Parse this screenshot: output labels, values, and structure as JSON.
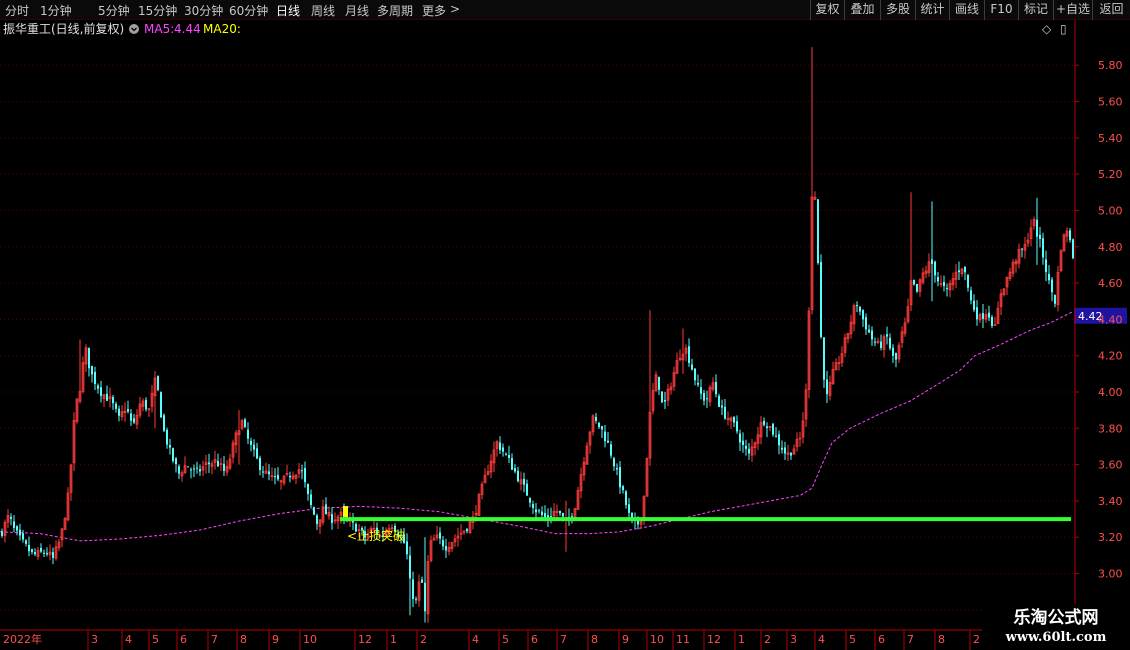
{
  "toolbar": {
    "periods": [
      "分时",
      "1分钟",
      "5分钟",
      "15分钟",
      "30分钟",
      "60分钟",
      "日线",
      "周线",
      "月线",
      "多周期",
      "更多"
    ],
    "active_period": "日线",
    "more_arrow": ">",
    "tools": [
      "复权",
      "叠加",
      "多股",
      "统计",
      "画线",
      "F10",
      "标记",
      "+自选",
      "返回"
    ]
  },
  "info": {
    "stock_name": "振华重工(日线,前复权)",
    "ma5_label": "MA5:",
    "ma5_value": "4.44",
    "ma20_label": "MA20:",
    "ma20_value": "",
    "diamond_icon": "◇",
    "panel_icon": "▯"
  },
  "colors": {
    "up": "#ff3c3c",
    "down": "#54ffff",
    "ma": "#ff44ff",
    "support": "#33ff33",
    "annotation": "#ffff00",
    "axis": "#b40000",
    "grid": "#5a0000",
    "price_tag": "#1e14a0",
    "ma5_label": "#ffffff",
    "ma5_value": "#ff44ff",
    "ma20_label": "#ffff00"
  },
  "chart_data": {
    "type": "candlestick",
    "ylim": [
      2.7,
      5.95
    ],
    "yticks": [
      2.8,
      3.0,
      3.2,
      3.4,
      3.6,
      3.8,
      4.0,
      4.2,
      4.4,
      4.6,
      4.8,
      5.0,
      5.2,
      5.4,
      5.6,
      5.8
    ],
    "ytick_labels": [
      "2.80",
      "3.00",
      "3.20",
      "3.40",
      "3.60",
      "3.80",
      "4.00",
      "4.20",
      "4.40",
      "4.60",
      "4.80",
      "5.00",
      "5.20",
      "5.40",
      "5.60",
      "5.80"
    ],
    "x_tick_labels": [
      "2022年",
      "3",
      "4",
      "5",
      "6",
      "7",
      "8",
      "9",
      "10",
      "12",
      "1",
      "2",
      "4",
      "5",
      "6",
      "7",
      "8",
      "9",
      "10",
      "11",
      "12",
      "1",
      "2",
      "3",
      "4",
      "5",
      "6",
      "7",
      "8",
      "2"
    ],
    "last_price": 4.42,
    "last_price_label": "4.42",
    "support_level": 3.3,
    "annotation": "<止损突破",
    "price_path": [
      [
        0,
        3.22
      ],
      [
        8,
        3.32
      ],
      [
        12,
        3.25
      ],
      [
        20,
        3.18
      ],
      [
        32,
        3.1
      ],
      [
        45,
        3.12
      ],
      [
        52,
        3.08
      ],
      [
        60,
        3.2
      ],
      [
        68,
        3.45
      ],
      [
        74,
        3.9
      ],
      [
        80,
        4.05
      ],
      [
        84,
        4.25
      ],
      [
        90,
        4.1
      ],
      [
        100,
        4.0
      ],
      [
        110,
        3.95
      ],
      [
        118,
        3.85
      ],
      [
        125,
        3.92
      ],
      [
        132,
        3.8
      ],
      [
        140,
        3.95
      ],
      [
        148,
        3.9
      ],
      [
        155,
        4.08
      ],
      [
        162,
        3.8
      ],
      [
        170,
        3.65
      ],
      [
        178,
        3.55
      ],
      [
        185,
        3.6
      ],
      [
        195,
        3.55
      ],
      [
        205,
        3.6
      ],
      [
        215,
        3.62
      ],
      [
        225,
        3.55
      ],
      [
        232,
        3.7
      ],
      [
        240,
        3.85
      ],
      [
        248,
        3.72
      ],
      [
        258,
        3.6
      ],
      [
        265,
        3.55
      ],
      [
        272,
        3.52
      ],
      [
        280,
        3.5
      ],
      [
        290,
        3.55
      ],
      [
        300,
        3.58
      ],
      [
        308,
        3.4
      ],
      [
        316,
        3.28
      ],
      [
        322,
        3.35
      ],
      [
        330,
        3.3
      ],
      [
        340,
        3.32
      ],
      [
        348,
        3.28
      ],
      [
        356,
        3.25
      ],
      [
        364,
        3.2
      ],
      [
        372,
        3.25
      ],
      [
        380,
        3.2
      ],
      [
        390,
        3.28
      ],
      [
        398,
        3.22
      ],
      [
        405,
        3.15
      ],
      [
        410,
        2.9
      ],
      [
        415,
        2.85
      ],
      [
        420,
        3.0
      ],
      [
        424,
        2.78
      ],
      [
        428,
        3.15
      ],
      [
        435,
        3.2
      ],
      [
        445,
        3.15
      ],
      [
        455,
        3.2
      ],
      [
        465,
        3.25
      ],
      [
        472,
        3.3
      ],
      [
        480,
        3.45
      ],
      [
        488,
        3.6
      ],
      [
        496,
        3.72
      ],
      [
        505,
        3.65
      ],
      [
        515,
        3.55
      ],
      [
        525,
        3.45
      ],
      [
        535,
        3.35
      ],
      [
        545,
        3.3
      ],
      [
        555,
        3.35
      ],
      [
        565,
        3.28
      ],
      [
        573,
        3.35
      ],
      [
        580,
        3.55
      ],
      [
        587,
        3.75
      ],
      [
        592,
        3.85
      ],
      [
        600,
        3.8
      ],
      [
        608,
        3.7
      ],
      [
        616,
        3.55
      ],
      [
        624,
        3.4
      ],
      [
        630,
        3.28
      ],
      [
        636,
        3.26
      ],
      [
        642,
        3.35
      ],
      [
        646,
        3.65
      ],
      [
        650,
        3.95
      ],
      [
        656,
        4.1
      ],
      [
        662,
        3.9
      ],
      [
        670,
        4.05
      ],
      [
        678,
        4.2
      ],
      [
        684,
        4.25
      ],
      [
        690,
        4.15
      ],
      [
        698,
        4.0
      ],
      [
        705,
        3.95
      ],
      [
        712,
        4.05
      ],
      [
        720,
        3.9
      ],
      [
        728,
        3.85
      ],
      [
        735,
        3.8
      ],
      [
        742,
        3.7
      ],
      [
        748,
        3.65
      ],
      [
        755,
        3.75
      ],
      [
        762,
        3.85
      ],
      [
        770,
        3.8
      ],
      [
        778,
        3.72
      ],
      [
        786,
        3.65
      ],
      [
        794,
        3.7
      ],
      [
        800,
        3.75
      ],
      [
        806,
        4.05
      ],
      [
        812,
        5.3
      ],
      [
        816,
        4.85
      ],
      [
        820,
        4.3
      ],
      [
        825,
        3.95
      ],
      [
        832,
        4.1
      ],
      [
        840,
        4.2
      ],
      [
        848,
        4.35
      ],
      [
        855,
        4.5
      ],
      [
        862,
        4.4
      ],
      [
        870,
        4.3
      ],
      [
        878,
        4.25
      ],
      [
        886,
        4.3
      ],
      [
        894,
        4.15
      ],
      [
        900,
        4.3
      ],
      [
        906,
        4.4
      ],
      [
        910,
        4.6
      ],
      [
        916,
        4.55
      ],
      [
        922,
        4.65
      ],
      [
        930,
        4.72
      ],
      [
        938,
        4.6
      ],
      [
        946,
        4.55
      ],
      [
        954,
        4.65
      ],
      [
        962,
        4.7
      ],
      [
        970,
        4.5
      ],
      [
        978,
        4.4
      ],
      [
        986,
        4.45
      ],
      [
        994,
        4.35
      ],
      [
        1000,
        4.55
      ],
      [
        1008,
        4.65
      ],
      [
        1016,
        4.75
      ],
      [
        1024,
        4.8
      ],
      [
        1032,
        4.95
      ],
      [
        1040,
        4.8
      ],
      [
        1048,
        4.6
      ],
      [
        1054,
        4.5
      ],
      [
        1060,
        4.8
      ],
      [
        1066,
        4.9
      ],
      [
        1072,
        4.75
      ]
    ],
    "spikes": [
      [
        812,
        5.9,
        4.6
      ],
      [
        909,
        5.1,
        4.45
      ],
      [
        930,
        5.05,
        4.5
      ],
      [
        1035,
        5.07,
        4.7
      ],
      [
        650,
        4.45,
        3.9
      ],
      [
        683,
        4.35,
        4.1
      ],
      [
        424,
        3.2,
        2.73
      ],
      [
        410,
        3.1,
        2.77
      ],
      [
        566,
        3.4,
        3.12
      ],
      [
        79,
        4.29,
        3.95
      ],
      [
        237,
        3.9,
        3.6
      ],
      [
        155,
        4.1,
        3.8
      ]
    ],
    "ma20_path": [
      [
        0,
        3.23
      ],
      [
        40,
        3.22
      ],
      [
        80,
        3.18
      ],
      [
        120,
        3.19
      ],
      [
        160,
        3.21
      ],
      [
        200,
        3.24
      ],
      [
        240,
        3.29
      ],
      [
        280,
        3.33
      ],
      [
        320,
        3.36
      ],
      [
        360,
        3.37
      ],
      [
        400,
        3.36
      ],
      [
        440,
        3.34
      ],
      [
        480,
        3.3
      ],
      [
        520,
        3.26
      ],
      [
        555,
        3.22
      ],
      [
        590,
        3.22
      ],
      [
        620,
        3.23
      ],
      [
        650,
        3.26
      ],
      [
        680,
        3.3
      ],
      [
        710,
        3.34
      ],
      [
        740,
        3.37
      ],
      [
        770,
        3.4
      ],
      [
        800,
        3.43
      ],
      [
        812,
        3.47
      ],
      [
        822,
        3.6
      ],
      [
        832,
        3.72
      ],
      [
        850,
        3.8
      ],
      [
        880,
        3.88
      ],
      [
        910,
        3.95
      ],
      [
        940,
        4.05
      ],
      [
        960,
        4.12
      ],
      [
        975,
        4.2
      ],
      [
        1000,
        4.26
      ],
      [
        1030,
        4.34
      ],
      [
        1050,
        4.38
      ],
      [
        1072,
        4.44
      ]
    ]
  }
}
